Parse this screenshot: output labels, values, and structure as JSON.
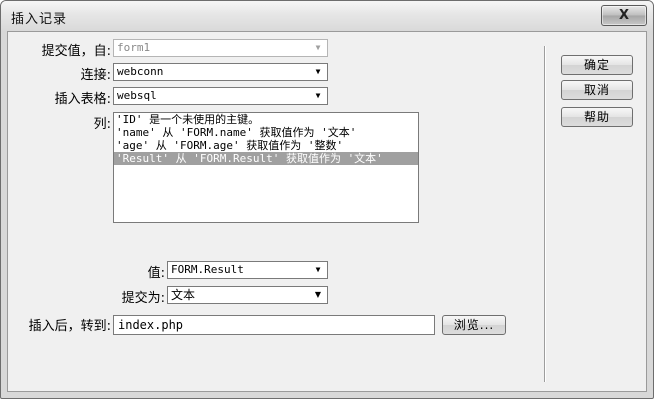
{
  "window": {
    "title": "插入记录",
    "close_label": "X"
  },
  "form": {
    "submit_from_label": "提交值，自:",
    "submit_from_value": "form1",
    "connection_label": "连接:",
    "connection_value": "webconn",
    "table_label": "插入表格:",
    "table_value": "websql",
    "columns_label": "列:",
    "columns": [
      "'ID' 是一个未使用的主键。",
      "'name' 从 'FORM.name' 获取值作为 '文本'",
      "'age' 从 'FORM.age' 获取值作为 '整数'",
      "'Result' 从 'FORM.Result' 获取值作为 '文本'"
    ],
    "selected_column_index": 3,
    "value_label": "值:",
    "value_value": "FORM.Result",
    "submit_as_label": "提交为:",
    "submit_as_value": "文本",
    "after_insert_label": "插入后，转到:",
    "after_insert_value": "index.php",
    "browse_label": "浏览..."
  },
  "buttons": {
    "ok": "确定",
    "cancel": "取消",
    "help": "帮助"
  },
  "icons": {
    "dropdown_arrow": "▼"
  }
}
